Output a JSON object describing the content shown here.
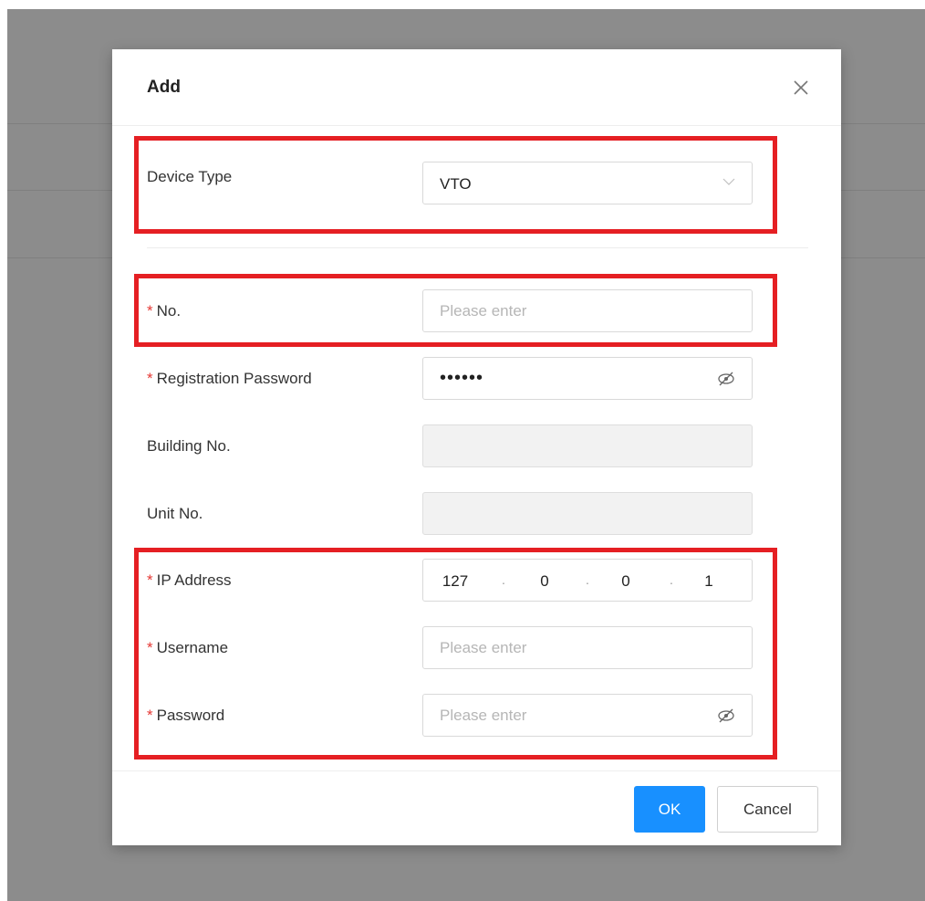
{
  "dialog": {
    "title": "Add",
    "device_type": {
      "label": "Device Type",
      "value": "VTO"
    },
    "no": {
      "label": "No.",
      "placeholder": "Please enter"
    },
    "registration_password": {
      "label": "Registration Password",
      "value": "••••••"
    },
    "building_no": {
      "label": "Building No."
    },
    "unit_no": {
      "label": "Unit No."
    },
    "ip_address": {
      "label": "IP Address",
      "octets": [
        "127",
        "0",
        "0",
        "1"
      ],
      "separator": "."
    },
    "username": {
      "label": "Username",
      "placeholder": "Please enter"
    },
    "password": {
      "label": "Password",
      "placeholder": "Please enter"
    },
    "required_mark": "*",
    "ok_label": "OK",
    "cancel_label": "Cancel"
  },
  "colors": {
    "primary": "#1890ff",
    "required": "#e53935",
    "highlight": "#e51f23",
    "overlay": "#8c8c8c"
  }
}
